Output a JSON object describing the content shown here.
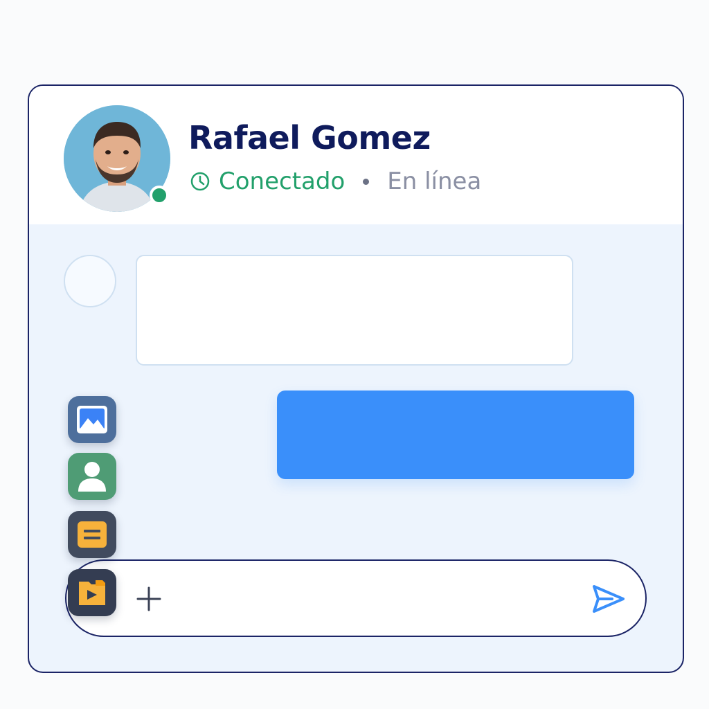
{
  "contact": {
    "name": "Rafael Gomez",
    "status": "Conectado",
    "presence": "En línea",
    "online_indicator_color": "#22a06b"
  },
  "icons": {
    "status": "clock-icon",
    "attachments": [
      "image-icon",
      "contact-icon",
      "document-icon",
      "media-icon"
    ],
    "composer_add": "plus-icon",
    "composer_send": "send-icon"
  },
  "colors": {
    "accent": "#3a8ffa",
    "title": "#0f1b5c",
    "status": "#22a06b",
    "muted": "#8a8fa3",
    "chat_background": "#edf4fd"
  }
}
